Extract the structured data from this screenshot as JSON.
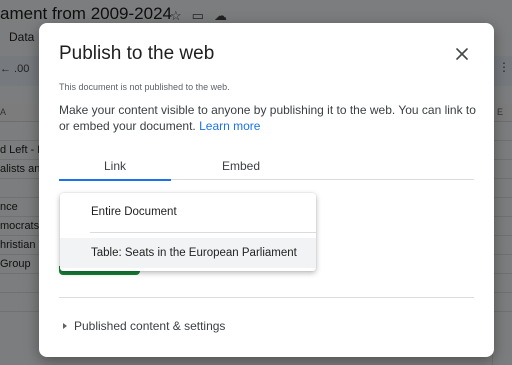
{
  "background": {
    "doc_title_fragment": "ament from 2009-2024",
    "menu_item_fragment": "Data",
    "toolbar_fragment": "←  .00",
    "col_a": "A",
    "col_e": "E",
    "rows": [
      "",
      "d Left - N",
      "alists an",
      "",
      "nce",
      "mocrats i",
      "hristian",
      "Group",
      "",
      ""
    ]
  },
  "dialog": {
    "title": "Publish to the web",
    "status": "This document is not published to the web.",
    "description": "Make your content visible to anyone by publishing it to the web. You can link to or embed your document.",
    "learn_more": "Learn more",
    "tabs": [
      {
        "label": "Link",
        "active": true
      },
      {
        "label": "Embed",
        "active": false
      }
    ],
    "dropdown": {
      "options": [
        "Entire Document",
        "Table: Seats in the European Parliament"
      ],
      "highlighted_index": 1
    },
    "settings_label": "Published content & settings"
  },
  "colors": {
    "accent": "#1a73e8",
    "publish_button": "#188038",
    "scrim": "rgba(0,0,0,0.5)"
  }
}
